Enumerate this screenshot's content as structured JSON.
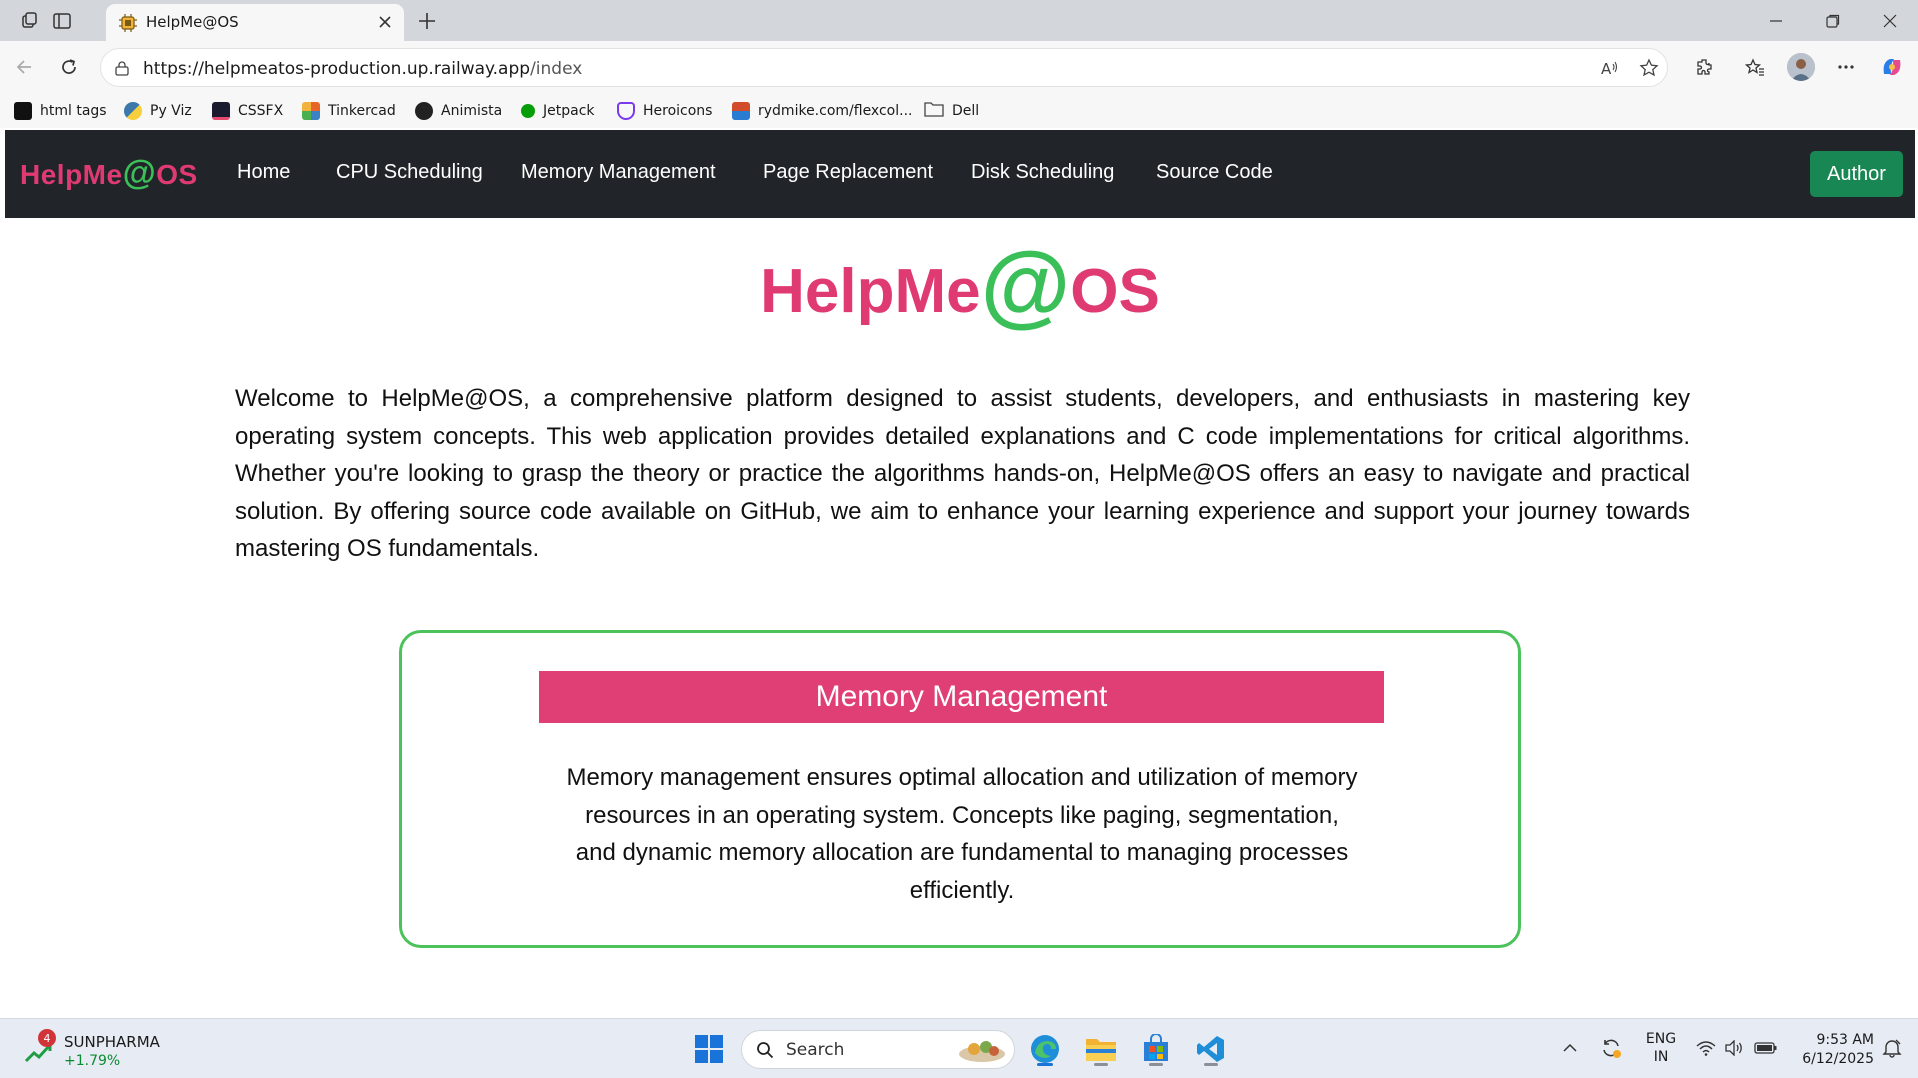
{
  "browser": {
    "tab_title": "HelpMe@OS",
    "url_host": "https://helpmeatos-production.up.railway.app",
    "url_path": "/index",
    "bookmarks": [
      {
        "label": "html tags",
        "icon": "html-tags-icon",
        "color": "#111111"
      },
      {
        "label": "Py Viz",
        "icon": "python-icon",
        "color": "#3c78aa"
      },
      {
        "label": "CSSFX",
        "icon": "cssfx-icon",
        "color": "#1b1b2f"
      },
      {
        "label": "Tinkercad",
        "icon": "tinkercad-icon",
        "color": "#e8652a"
      },
      {
        "label": "Animista",
        "icon": "animista-icon",
        "color": "#222222"
      },
      {
        "label": "Jetpack",
        "icon": "jetpack-icon",
        "color": "#069e08"
      },
      {
        "label": "Heroicons",
        "icon": "heroicons-icon",
        "color": "#7c3aed"
      },
      {
        "label": "rydmike.com/flexcol...",
        "icon": "flex-color-icon",
        "color": "#d24b2a"
      },
      {
        "label": "Dell",
        "icon": "folder-icon",
        "color": "#444444"
      }
    ]
  },
  "site": {
    "brand_prefix": "HelpMe",
    "brand_at": "@",
    "brand_suffix": "OS",
    "nav": [
      "Home",
      "CPU Scheduling",
      "Memory Management",
      "Page Replacement",
      "Disk Scheduling",
      "Source Code"
    ],
    "author_label": "Author",
    "intro": "Welcome to HelpMe@OS, a comprehensive platform designed to assist students, developers, and enthusiasts in mastering key operating system concepts. This web application provides detailed explanations and C code implementations for critical algorithms. Whether you're looking to grasp the theory or practice the algorithms hands-on, HelpMe@OS offers an easy to navigate and practical solution. By offering source code available on GitHub, we aim to enhance your learning experience and support your journey towards mastering OS fundamentals.",
    "card": {
      "title": "Memory Management",
      "text": "Memory management ensures optimal allocation and utilization of memory resources in an operating system. Concepts like paging, segmentation, and dynamic memory allocation are fundamental to managing processes efficiently."
    },
    "colors": {
      "brand_pink": "#e03a72",
      "brand_green": "#3bbf59",
      "nav_bg": "#212529",
      "author_green": "#198754"
    }
  },
  "taskbar": {
    "stock_name": "SUNPHARMA",
    "stock_change": "+1.79%",
    "stock_badge": "4",
    "search_label": "Search",
    "lang_line1": "ENG",
    "lang_line2": "IN",
    "time": "9:53 AM",
    "date": "6/12/2025"
  }
}
